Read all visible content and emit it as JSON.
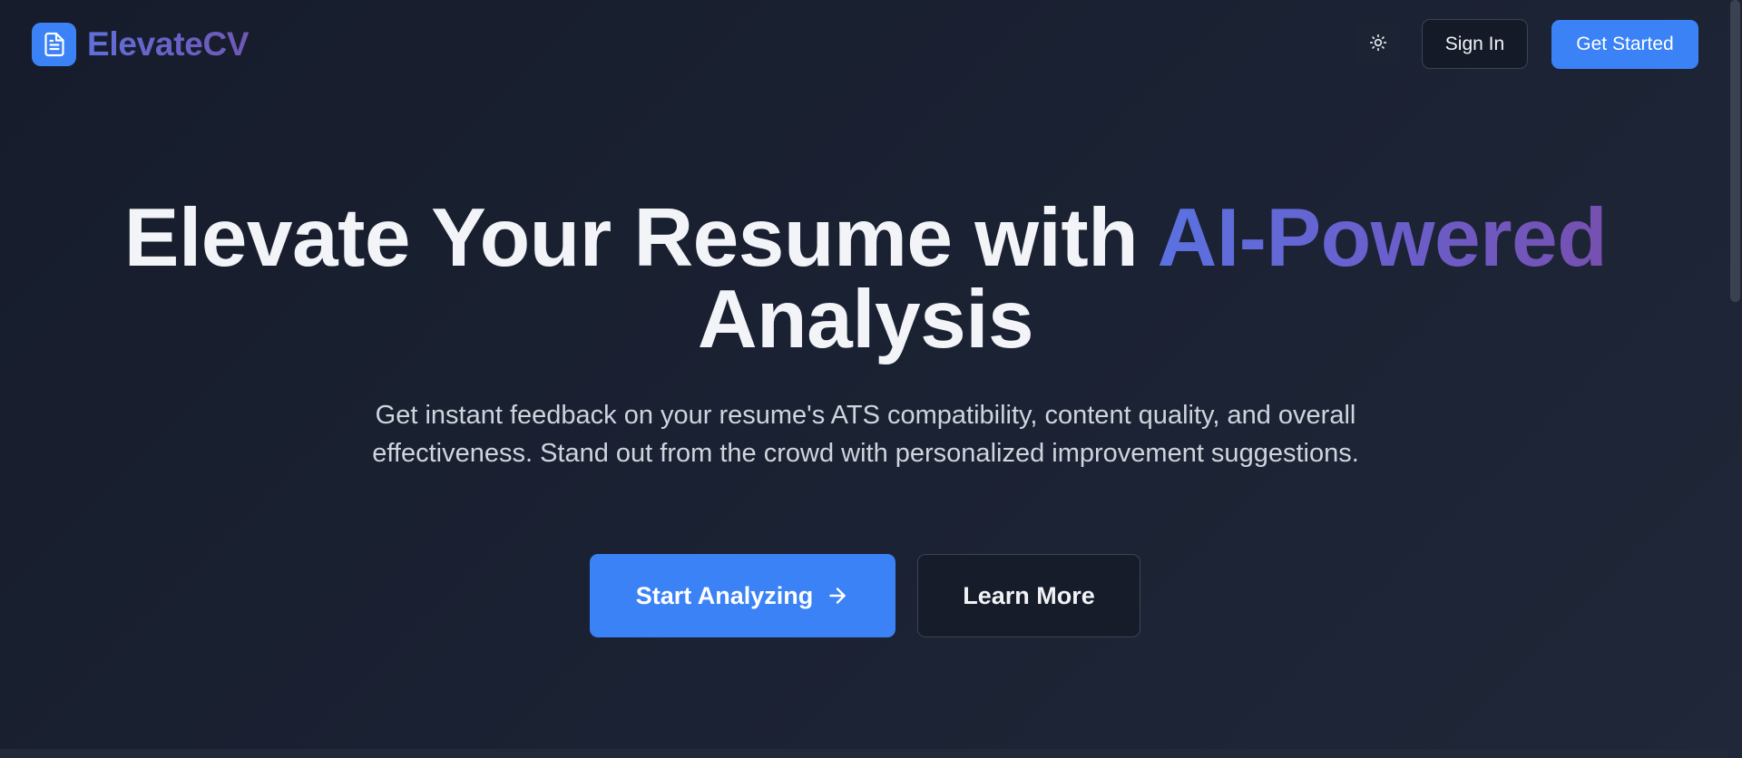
{
  "brand": {
    "name": "ElevateCV",
    "logo_icon": "document-icon",
    "accent_color": "#3b82f6"
  },
  "header": {
    "theme_toggle_icon": "sun-icon",
    "signin_label": "Sign In",
    "get_started_label": "Get Started"
  },
  "hero": {
    "title_main": "Elevate Your Resume with",
    "title_accent": "AI-Powered",
    "title_end": "Analysis",
    "subtitle": "Get instant feedback on your resume's ATS compatibility, content quality, and overall effectiveness. Stand out from the crowd with personalized improvement suggestions.",
    "primary_cta": "Start Analyzing",
    "primary_cta_icon": "arrow-right-icon",
    "secondary_cta": "Learn More"
  }
}
